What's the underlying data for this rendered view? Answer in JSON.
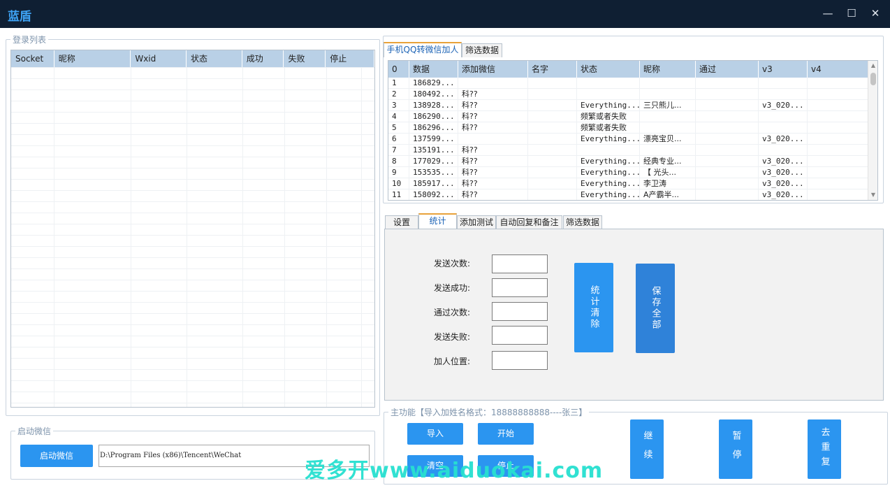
{
  "window": {
    "title": "蓝盾",
    "minimize": "—",
    "maximize": "☐",
    "close": "✕"
  },
  "login_list": {
    "label": "登录列表",
    "columns": [
      "Socket",
      "昵称",
      "Wxid",
      "状态",
      "成功",
      "失败",
      "停止"
    ]
  },
  "launch": {
    "label": "启动微信",
    "button": "启动微信",
    "path": "D:\\Program Files (x86)\\Tencent\\WeChat"
  },
  "top_tabs": [
    "手机QQ转微信加人",
    "筛选数据"
  ],
  "data_table": {
    "columns": [
      "0",
      "数据",
      "添加微信",
      "名字",
      "状态",
      "昵称",
      "通过",
      "v3",
      "v4"
    ],
    "rows": [
      [
        "1",
        "186829...",
        "",
        "",
        "",
        "",
        "",
        "",
        ""
      ],
      [
        "2",
        "180492...",
        "科??",
        "",
        "",
        "",
        "",
        "",
        ""
      ],
      [
        "3",
        "138928...",
        "科??",
        "",
        "Everything...",
        "三只熊儿...",
        "",
        "v3_020...",
        ""
      ],
      [
        "4",
        "186290...",
        "科??",
        "",
        "频繁或者失败",
        "",
        "",
        "",
        ""
      ],
      [
        "5",
        "186296...",
        "科??",
        "",
        "频繁或者失败",
        "",
        "",
        "",
        ""
      ],
      [
        "6",
        "137599...",
        "",
        "",
        "Everything...",
        "漂亮宝贝...",
        "",
        "v3_020...",
        ""
      ],
      [
        "7",
        "135191...",
        "科??",
        "",
        "",
        "",
        "",
        "",
        ""
      ],
      [
        "8",
        "177029...",
        "科??",
        "",
        "Everything...",
        "经典专业...",
        "",
        "v3_020...",
        ""
      ],
      [
        "9",
        "153535...",
        "科??",
        "",
        "Everything...",
        "【 光头...",
        "",
        "v3_020...",
        ""
      ],
      [
        "10",
        "185917...",
        "科??",
        "",
        "Everything...",
        "李卫涛",
        "",
        "v3_020...",
        ""
      ],
      [
        "11",
        "158092...",
        "科??",
        "",
        "Everything...",
        "A产霸半...",
        "",
        "v3_020...",
        ""
      ]
    ]
  },
  "mid_tabs": [
    "设置",
    "统计",
    "添加测试",
    "自动回复和备注",
    "筛选数据"
  ],
  "stats": {
    "labels": [
      "发送次数:",
      "发送成功:",
      "通过次数:",
      "发送失败:",
      "加人位置:"
    ],
    "clear_button": "统计清除",
    "save_button": "保存全部"
  },
  "main": {
    "label": "主功能【导入加姓名格式：18888888888----张三】",
    "import_button": "导入",
    "start_button": "开始",
    "clear_button": "清空",
    "stop_button": "停止",
    "continue_button": "继续",
    "pause_button": "暂停",
    "dedupe_button": "去重复"
  },
  "watermark": "爱多开www.aiduokai.com"
}
